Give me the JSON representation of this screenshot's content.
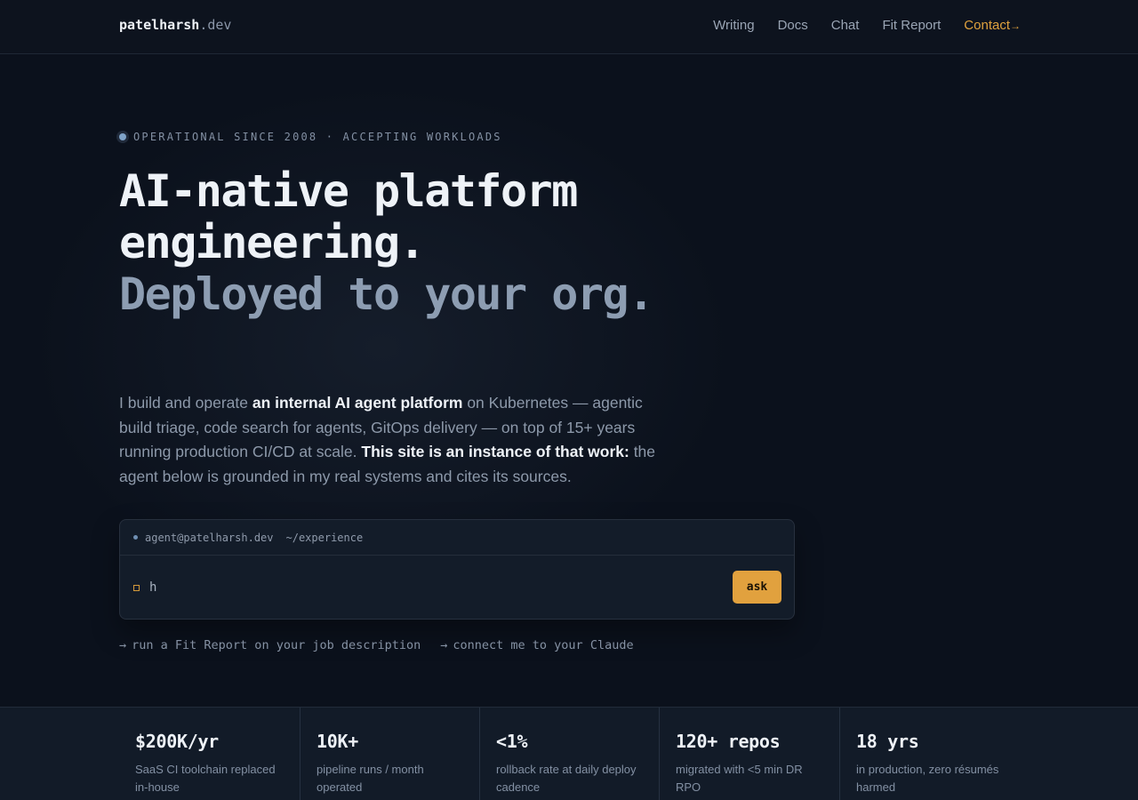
{
  "header": {
    "logo_name": "patelharsh",
    "logo_tld": ".dev",
    "nav": [
      "Writing",
      "Docs",
      "Chat",
      "Fit Report"
    ],
    "contact_label": "Contact",
    "contact_arrow": "→"
  },
  "hero": {
    "status": "OPERATIONAL SINCE 2008 · ACCEPTING WORKLOADS",
    "headline_line1": "AI-native platform engineering.",
    "headline_line2": "Deployed to your org.",
    "lede": {
      "p1": "I build and operate ",
      "b1": "an internal AI agent platform",
      "p2": " on Kubernetes — agentic build triage, code search for agents, GitOps delivery — on top of 15+ years running production CI/CD at scale. ",
      "b2": "This site is an instance of that work:",
      "p3": " the agent below is grounded in my real systems and cites its sources."
    }
  },
  "terminal": {
    "agent": "agent@patelharsh.dev",
    "path": "~/experience",
    "input_value": "h",
    "ask_label": "ask"
  },
  "links": [
    {
      "arrow": "→",
      "label": "run a Fit Report on your job description"
    },
    {
      "arrow": "→",
      "label": "connect me to your Claude"
    }
  ],
  "stats": [
    {
      "value": "$200K/yr",
      "label": "SaaS CI toolchain replaced in-house"
    },
    {
      "value": "10K+",
      "label": "pipeline runs / month operated"
    },
    {
      "value": "<1%",
      "label": "rollback rate at daily deploy cadence"
    },
    {
      "value": "120+ repos",
      "label": "migrated with <5 min DR RPO"
    },
    {
      "value": "18 yrs",
      "label": "in production, zero résumés harmed"
    }
  ],
  "colors": {
    "background": "#0b111c",
    "accent": "#e1a13e",
    "muted_heading": "#8d9db2"
  }
}
